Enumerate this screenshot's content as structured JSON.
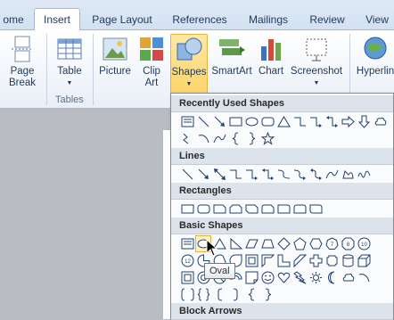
{
  "tabs": [
    {
      "label": "ome",
      "active": false
    },
    {
      "label": "Insert",
      "active": true
    },
    {
      "label": "Page Layout",
      "active": false
    },
    {
      "label": "References",
      "active": false
    },
    {
      "label": "Mailings",
      "active": false
    },
    {
      "label": "Review",
      "active": false
    },
    {
      "label": "View",
      "active": false
    }
  ],
  "ribbon": {
    "page_break": [
      "Page",
      "Break"
    ],
    "table": "Table",
    "tables_group": "Tables",
    "picture": "Picture",
    "clip_art": [
      "Clip",
      "Art"
    ],
    "shapes": "Shapes",
    "smartart": "SmartArt",
    "chart": "Chart",
    "screenshot": "Screenshot",
    "hyperlink": "Hyperlin"
  },
  "dropdown": {
    "sections": {
      "recent": "Recently Used Shapes",
      "lines": "Lines",
      "rectangles": "Rectangles",
      "basic": "Basic Shapes",
      "block_arrows": "Block Arrows"
    },
    "tooltip": "Oval"
  },
  "colors": {
    "accent": "#fcd46a",
    "ribbon_text": "#1e395b",
    "shape_stroke": "#1f3f6e"
  }
}
